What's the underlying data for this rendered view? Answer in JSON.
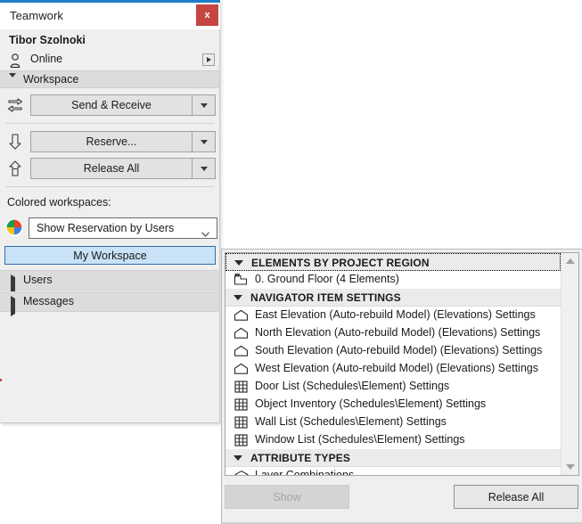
{
  "teamwork_palette": {
    "title": "Teamwork",
    "close_label": "x",
    "user_name": "Tibor Szolnoki",
    "status": "Online",
    "status_icon": "person-icon",
    "workspace_section": {
      "label": "Workspace",
      "expanded": true
    },
    "actions": [
      {
        "label": "Send & Receive",
        "icon": "send-receive-arrows-icon"
      },
      {
        "label": "Reserve...",
        "icon": "down-arrow-icon"
      },
      {
        "label": "Release All",
        "icon": "up-arrow-outline-icon"
      }
    ],
    "colored_workspaces_label": "Colored workspaces:",
    "colored_workspaces_icon": "four-color-pie-icon",
    "colored_workspaces_value": "Show Reservation by Users",
    "my_workspace_label": "My Workspace",
    "collapsed_sections": [
      {
        "label": "Users"
      },
      {
        "label": "Messages"
      }
    ]
  },
  "reserve_dialog": {
    "groups": [
      {
        "label": "ELEMENTS BY PROJECT REGION",
        "expanded": true,
        "focused": true,
        "items": [
          {
            "label": "0. Ground Floor (4 Elements)",
            "icon": "story-floorplan-icon"
          }
        ]
      },
      {
        "label": "NAVIGATOR ITEM SETTINGS",
        "expanded": true,
        "focused": false,
        "items": [
          {
            "label": "East Elevation (Auto-rebuild Model) (Elevations) Settings",
            "icon": "elevation-house-icon"
          },
          {
            "label": "North Elevation (Auto-rebuild Model) (Elevations) Settings",
            "icon": "elevation-house-icon"
          },
          {
            "label": "South Elevation (Auto-rebuild Model) (Elevations) Settings",
            "icon": "elevation-house-icon"
          },
          {
            "label": "West Elevation (Auto-rebuild Model) (Elevations) Settings",
            "icon": "elevation-house-icon"
          },
          {
            "label": "Door List (Schedules\\Element) Settings",
            "icon": "schedule-table-icon"
          },
          {
            "label": "Object Inventory (Schedules\\Element) Settings",
            "icon": "schedule-table-icon"
          },
          {
            "label": "Wall List (Schedules\\Element) Settings",
            "icon": "schedule-table-icon"
          },
          {
            "label": "Window List (Schedules\\Element) Settings",
            "icon": "schedule-table-icon"
          }
        ]
      },
      {
        "label": "ATTRIBUTE TYPES",
        "expanded": true,
        "focused": false,
        "items": [
          {
            "label": "Layer Combinations",
            "icon": "layer-combinations-icon"
          }
        ]
      }
    ],
    "buttons": {
      "show": "Show",
      "release_all": "Release All"
    }
  },
  "colors": {
    "accent_blue": "#1e7ec8",
    "close_red": "#c5453f",
    "selection_blue": "#c9e2f7",
    "panel_gray": "#efefef"
  }
}
